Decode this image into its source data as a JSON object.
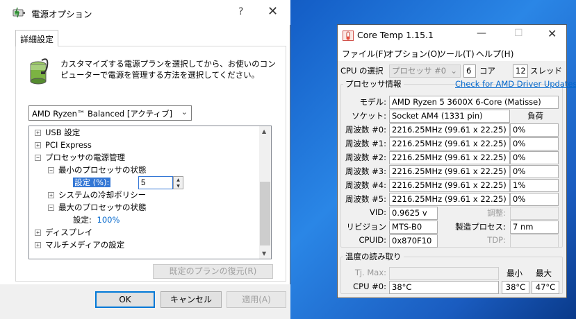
{
  "power_window": {
    "title": "電源オプション",
    "help": "?",
    "close": "✕",
    "tab": "詳細設定",
    "description": "カスタマイズする電源プランを選択してから、お使いのコンピューターで電源を管理する方法を選択してください。",
    "plan": "AMD Ryzen™ Balanced [アクティブ]",
    "tree": {
      "usb": "USB 設定",
      "pci": "PCI Express",
      "cpu_mgmt": "プロセッサの電源管理",
      "min_state": "最小のプロセッサの状態",
      "setting_label": "設定 (%):",
      "setting_value": "5",
      "cooling": "システムの冷却ポリシー",
      "max_state": "最大のプロセッサの状態",
      "max_setting_label": "設定:",
      "max_setting_value": "100%",
      "display": "ディスプレイ",
      "multimedia": "マルチメディアの設定"
    },
    "restore_button": "既定のプランの復元(R)",
    "ok": "OK",
    "cancel": "キャンセル",
    "apply": "適用(A)"
  },
  "coretemp": {
    "title": "Core Temp 1.15.1",
    "menu": [
      "ファイル(F)",
      "オプション(O)",
      "ツール(T)",
      "ヘルプ(H)"
    ],
    "cpu_select_label": "CPU の選択",
    "cpu_select_value": "プロセッサ #0",
    "cores": "6",
    "cores_label": "コア",
    "threads": "12",
    "threads_label": "スレッド",
    "processor_info": "プロセッサ情報",
    "amd_link": "Check for AMD Driver Updates",
    "model_label": "モデル:",
    "model": "AMD Ryzen 5 3600X 6-Core (Matisse)",
    "socket_label": "ソケット:",
    "socket": "Socket AM4 (1331 pin)",
    "load_header": "負荷",
    "freqs": [
      {
        "label": "周波数 #0:",
        "value": "2216.25MHz (99.61 x 22.25)",
        "load": "0%"
      },
      {
        "label": "周波数 #1:",
        "value": "2216.25MHz (99.61 x 22.25)",
        "load": "0%"
      },
      {
        "label": "周波数 #2:",
        "value": "2216.25MHz (99.61 x 22.25)",
        "load": "0%"
      },
      {
        "label": "周波数 #3:",
        "value": "2216.25MHz (99.61 x 22.25)",
        "load": "0%"
      },
      {
        "label": "周波数 #4:",
        "value": "2216.25MHz (99.61 x 22.25)",
        "load": "1%"
      },
      {
        "label": "周波数 #5:",
        "value": "2216.25MHz (99.61 x 22.25)",
        "load": "0%"
      }
    ],
    "vid_label": "VID:",
    "vid": "0.9625 v",
    "modulation_label": "調整:",
    "revision_label": "リビジョン",
    "revision": "MTS-B0",
    "process_label": "製造プロセス:",
    "process": "7 nm",
    "cpuid_label": "CPUID:",
    "cpuid": "0x870F10",
    "tdp_label": "TDP:",
    "temp_group": "温度の読み取り",
    "tjmax_label": "Tj. Max:",
    "min_header": "最小",
    "max_header": "最大",
    "cpu0_label": "CPU #0:",
    "cpu0_temp": "38°C",
    "cpu0_min": "38°C",
    "cpu0_max": "47°C"
  }
}
